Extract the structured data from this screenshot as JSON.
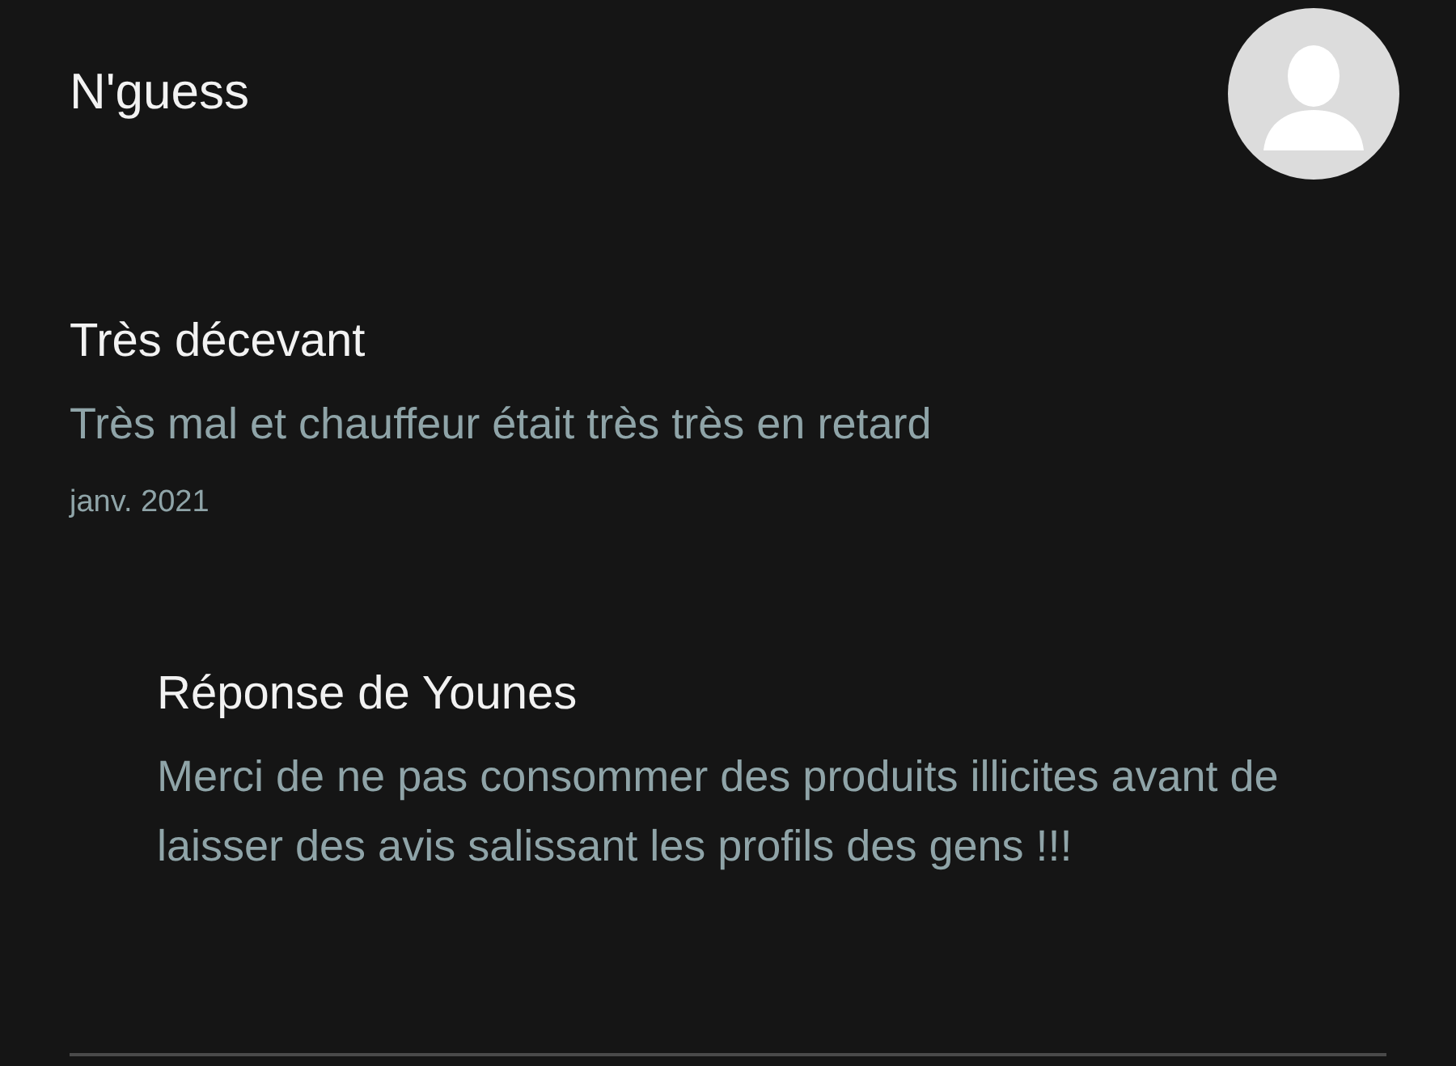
{
  "review": {
    "author": "N'guess",
    "title": "Très décevant",
    "body": "Très mal et chauffeur était très très en retard",
    "date": "janv. 2021"
  },
  "reply": {
    "title": "Réponse de Younes",
    "body": "Merci de ne pas consommer des produits illicites avant de laisser des avis salissant les profils des gens !!!"
  }
}
